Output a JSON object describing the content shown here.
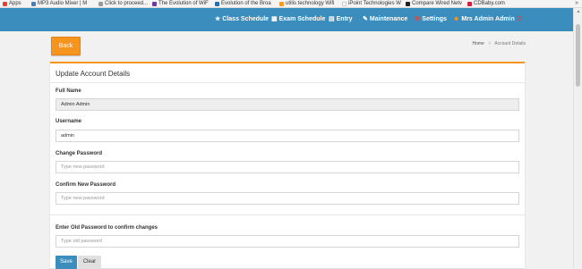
{
  "bookmarks": [
    {
      "label": "Apps",
      "color": "#e94235"
    },
    {
      "label": "MP3 Audio Mixer | M",
      "color": "#4a7fbd"
    },
    {
      "label": "Click to proceed...",
      "color": "#9b9b9b"
    },
    {
      "label": "The Evolution of WiF",
      "color": "#6a3d9a"
    },
    {
      "label": "Evolution of the Broa",
      "color": "#2b6cb0"
    },
    {
      "label": "utilis technology Wifi",
      "color": "#f59a23"
    },
    {
      "label": "iPoint Technologies W",
      "color": "#cccccc"
    },
    {
      "label": "Compare Wired Netv",
      "color": "#222222"
    },
    {
      "label": "CDBaby.com",
      "color": "#d21f3c"
    }
  ],
  "bookmarks_more": "»",
  "nav": {
    "items": [
      {
        "label": "Class Schedule",
        "icon": "★"
      },
      {
        "label": "Exam Schedule",
        "icon": "▦"
      },
      {
        "label": "Entry",
        "icon": "▤"
      },
      {
        "label": "Maintenance",
        "icon": "✎"
      },
      {
        "label": "Settings",
        "icon": "⚙"
      },
      {
        "label": "Mrs Admin Admin",
        "icon": "☻"
      }
    ],
    "power_icon": "⏻",
    "colors": {
      "bar": "#3b8dbd",
      "settings_icon": "#e94235",
      "user_icon": "#f7941d",
      "power_icon": "#e94235"
    }
  },
  "back_label": "Back",
  "breadcrumb": {
    "home": "Home",
    "separator": ">",
    "current": "Account Details"
  },
  "form": {
    "title": "Update Account Details",
    "full_name": {
      "label": "Full Name",
      "value": "Admin Admin"
    },
    "username": {
      "label": "Username",
      "value": "admin"
    },
    "change_password": {
      "label": "Change Password",
      "placeholder": "Type new password"
    },
    "confirm_password": {
      "label": "Confirm New Password",
      "placeholder": "Type new password"
    },
    "old_password": {
      "label": "Enter Old Password to confirm changes",
      "placeholder": "Type old password"
    },
    "save_label": "Save",
    "clear_label": "Clear"
  }
}
